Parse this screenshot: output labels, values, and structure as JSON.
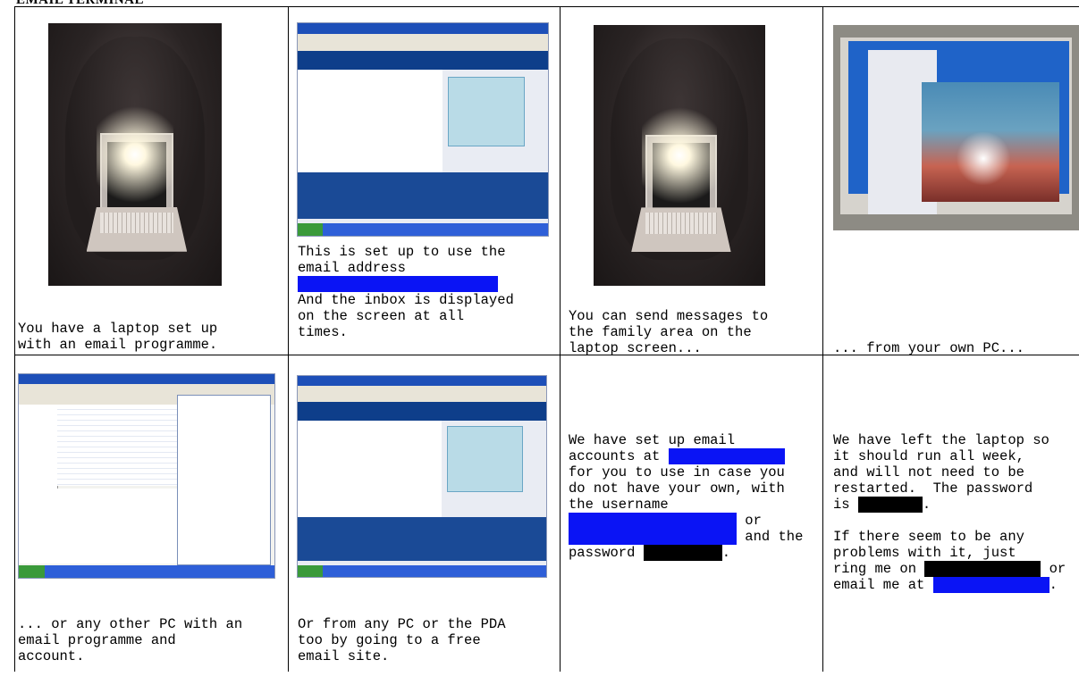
{
  "document": {
    "title": "EMAIL TERMINAL"
  },
  "cells": {
    "r1c1": {
      "line1": "You have a laptop set up",
      "line2": "with an email programme."
    },
    "r1c2": {
      "line1": "This is set up to use the",
      "line2": "email address",
      "line3": "And the inbox is displayed",
      "line4": "on the screen at all",
      "line5": "times."
    },
    "r1c3": {
      "line1": "You can send messages to",
      "line2": "the family area on the",
      "line3": "laptop screen..."
    },
    "r1c4": {
      "line1": "... from your own PC..."
    },
    "r2c1": {
      "line1": "... or any other PC with an",
      "line2": "email programme and",
      "line3": "account."
    },
    "r2c2": {
      "line1": "Or from any PC or the PDA",
      "line2": "too by going to a free",
      "line3": "email site."
    },
    "r2c3": {
      "line1a": "We have set up email",
      "line2a": "accounts at ",
      "line3": "for you to use in case you",
      "line4": "do not have your own, with",
      "line5": "the username",
      "line6b": " or",
      "line7b": " and the",
      "line8a": "password ",
      "line8b": "."
    },
    "r2c4": {
      "line1": "We have left the laptop so",
      "line2": "it should run all week,",
      "line3": "and will not need to be",
      "line4": "restarted.  The password",
      "line5a": "is ",
      "line5b": ".",
      "line7": "If there seem to be any",
      "line8": "problems with it, just",
      "line9a": "ring me on ",
      "line9b": " or",
      "line10a": "email me at ",
      "line10b": "."
    }
  },
  "redaction_colors": {
    "blue": "#0a14f5",
    "black": "#000000"
  }
}
